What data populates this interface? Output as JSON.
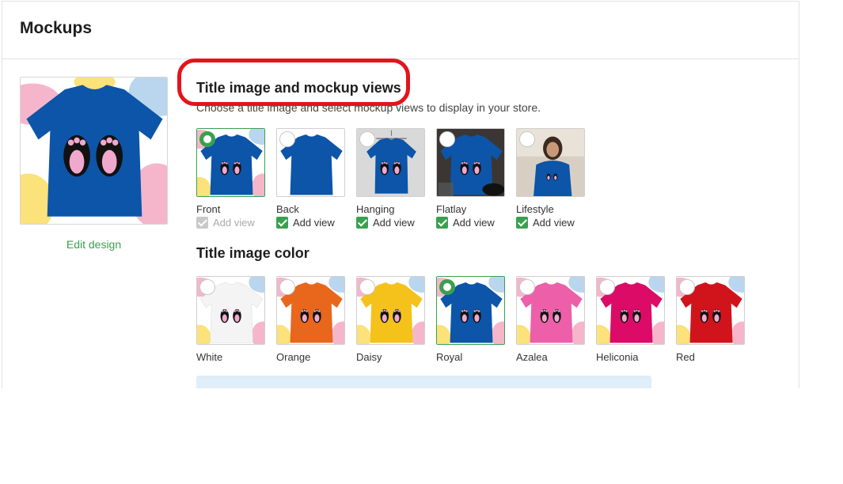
{
  "page_title": "Mockups",
  "preview": {
    "edit_label": "Edit design",
    "shirt_color": "#0c55a8"
  },
  "views_section": {
    "title": "Title image and mockup views",
    "description": "Choose a title image and select mockup views to display in your store.",
    "add_view_label": "Add view",
    "views": [
      {
        "label": "Front",
        "selected": true,
        "checked": true,
        "disabled": true
      },
      {
        "label": "Back",
        "selected": false,
        "checked": true,
        "disabled": false
      },
      {
        "label": "Hanging",
        "selected": false,
        "checked": true,
        "disabled": false
      },
      {
        "label": "Flatlay",
        "selected": false,
        "checked": true,
        "disabled": false
      },
      {
        "label": "Lifestyle",
        "selected": false,
        "checked": true,
        "disabled": false
      }
    ]
  },
  "color_section": {
    "title": "Title image color",
    "colors": [
      {
        "label": "White",
        "hex": "#f4f4f4",
        "selected": false
      },
      {
        "label": "Orange",
        "hex": "#e8671c",
        "selected": false
      },
      {
        "label": "Daisy",
        "hex": "#f5c21b",
        "selected": false
      },
      {
        "label": "Royal",
        "hex": "#0c55a8",
        "selected": true
      },
      {
        "label": "Azalea",
        "hex": "#ee5fa9",
        "selected": false
      },
      {
        "label": "Heliconia",
        "hex": "#db0b67",
        "selected": false
      },
      {
        "label": "Red",
        "hex": "#d1141b",
        "selected": false
      }
    ]
  },
  "accent_color": "#3aa04f",
  "annotation_color": "#e3141c"
}
